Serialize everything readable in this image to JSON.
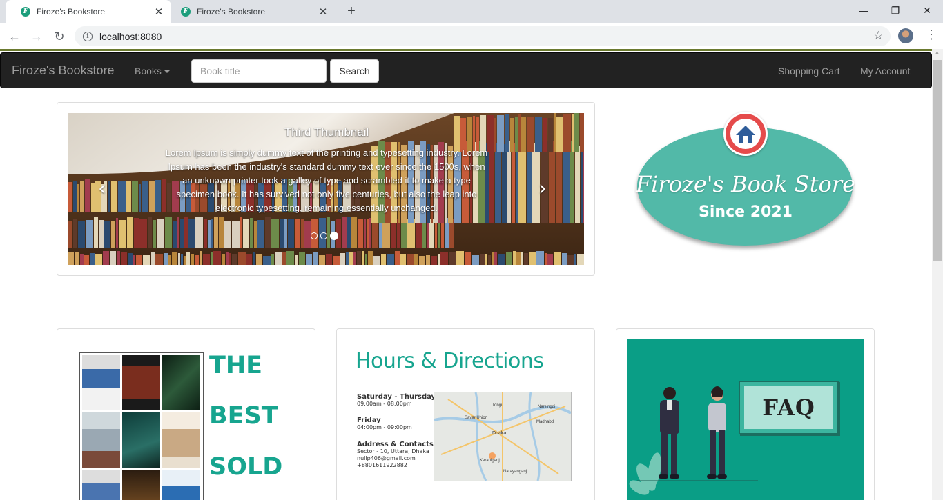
{
  "browser": {
    "tabs": [
      {
        "title": "Firoze's Bookstore",
        "favicon": "F",
        "active": true
      },
      {
        "title": "Firoze's Bookstore",
        "favicon": "F",
        "active": false
      }
    ],
    "url": "localhost:8080"
  },
  "navbar": {
    "brand": "Firoze's Bookstore",
    "books_menu": "Books",
    "search_placeholder": "Book title",
    "search_button": "Search",
    "shopping_cart": "Shopping Cart",
    "my_account": "My Account"
  },
  "carousel": {
    "title": "Third Thumbnail",
    "text": "Lorem Ipsum is simply dummy text of the printing and typesetting industry. Lorem Ipsum has been the industry's standard dummy text ever since the 1500s, when an unknown printer took a galley of type and scrambled it to make a type specimen book. It has survived not only five centuries, but also the leap into electronic typesetting, remaining essentially unchanged.",
    "slide_count": 3,
    "active_slide": 3
  },
  "logo": {
    "script_text": "Firoze's Book Store",
    "since_text": "Since 2021"
  },
  "cards": {
    "best_sold": {
      "words": [
        "THE",
        "BEST",
        "SOLD"
      ]
    },
    "hours": {
      "title": "Hours & Directions",
      "sat_thu_heading": "Saturday - Thursday",
      "sat_thu_time": "09:00am - 08:00pm",
      "friday_heading": "Friday",
      "friday_time": "04:00pm - 09:00pm",
      "address_heading": "Address & Contacts",
      "address_line": "Sector - 10, Uttara, Dhaka",
      "email": "nullp406@gmail.com",
      "phone": "+8801611922882",
      "map_labels": [
        "Tongi",
        "Savar Union",
        "Dhaka",
        "Narayanganj",
        "Keraniganj",
        "Narsingdi",
        "Madhabdi"
      ]
    },
    "faq": {
      "board_text": "FAQ"
    }
  },
  "colors": {
    "navbar_bg": "#222222",
    "brand_teal": "#17a58f",
    "logo_oval": "#52b9a8",
    "logo_house": "#e54b4b",
    "faq_bg": "#0a9e86"
  }
}
